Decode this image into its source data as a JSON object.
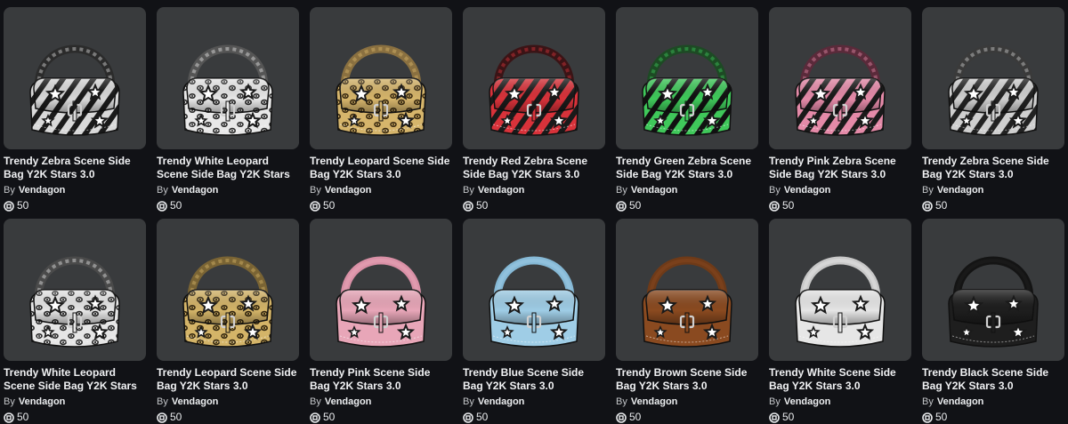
{
  "catalog": {
    "currency_icon": "robux-icon",
    "items": [
      {
        "name": "Trendy Zebra Scene Side Bag Y2K Stars 3.0",
        "by": "By",
        "creator": "Vendagon",
        "price": "50",
        "pattern": "zebra",
        "colors": {
          "base": "#d9d9d9",
          "accent": "#1a1a1a",
          "strap": "#2b2b2b"
        }
      },
      {
        "name": "Trendy White Leopard Scene Side Bag Y2K Stars 3.0",
        "by": "By",
        "creator": "Vendagon",
        "price": "50",
        "pattern": "leopard",
        "colors": {
          "base": "#e8e8e8",
          "accent": "#2a2a2a",
          "strap": "#555555"
        }
      },
      {
        "name": "Trendy Leopard Scene Side Bag Y2K Stars 3.0",
        "by": "By",
        "creator": "Vendagon",
        "price": "50",
        "pattern": "leopard",
        "colors": {
          "base": "#d6b56b",
          "accent": "#3a2a10",
          "strap": "#8a7040"
        }
      },
      {
        "name": "Trendy Red Zebra Scene Side Bag Y2K Stars 3.0",
        "by": "By",
        "creator": "Vendagon",
        "price": "50",
        "pattern": "zebra",
        "colors": {
          "base": "#d8323a",
          "accent": "#1a1a1a",
          "strap": "#3a1416"
        }
      },
      {
        "name": "Trendy Green Zebra Scene Side Bag Y2K Stars 3.0",
        "by": "By",
        "creator": "Vendagon",
        "price": "50",
        "pattern": "zebra",
        "colors": {
          "base": "#3fc85a",
          "accent": "#111111",
          "strap": "#1d4a24"
        }
      },
      {
        "name": "Trendy Pink Zebra Scene Side Bag Y2K Stars 3.0",
        "by": "By",
        "creator": "Vendagon",
        "price": "50",
        "pattern": "zebra",
        "colors": {
          "base": "#e48aa8",
          "accent": "#1a1a1a",
          "strap": "#5a2a3a"
        }
      },
      {
        "name": "Trendy Zebra Scene Side Bag Y2K Stars 3.0",
        "by": "By",
        "creator": "Vendagon",
        "price": "50",
        "pattern": "zebra",
        "colors": {
          "base": "#cfcfcf",
          "accent": "#222222",
          "strap": "#3a3a3a"
        }
      },
      {
        "name": "Trendy White Leopard Scene Side Bag Y2K Stars 3.0",
        "by": "By",
        "creator": "Vendagon",
        "price": "50",
        "pattern": "leopard",
        "colors": {
          "base": "#e6e6e6",
          "accent": "#2a2a2a",
          "strap": "#4a4a4a"
        }
      },
      {
        "name": "Trendy Leopard Scene Side Bag Y2K Stars 3.0",
        "by": "By",
        "creator": "Vendagon",
        "price": "50",
        "pattern": "leopard",
        "colors": {
          "base": "#d4b468",
          "accent": "#33260e",
          "strap": "#7a6434"
        }
      },
      {
        "name": "Trendy Pink Scene Side Bag Y2K Stars 3.0",
        "by": "By",
        "creator": "Vendagon",
        "price": "50",
        "pattern": "solid",
        "colors": {
          "base": "#e8a6b8",
          "accent": "#ffffff",
          "strap": "#d990a6"
        }
      },
      {
        "name": "Trendy Blue Scene Side Bag Y2K Stars 3.0",
        "by": "By",
        "creator": "Vendagon",
        "price": "50",
        "pattern": "solid",
        "colors": {
          "base": "#9fcde6",
          "accent": "#ffffff",
          "strap": "#86b9d6"
        }
      },
      {
        "name": "Trendy Brown Scene Side Bag Y2K Stars 3.0",
        "by": "By",
        "creator": "Vendagon",
        "price": "50",
        "pattern": "solid",
        "colors": {
          "base": "#8a4a20",
          "accent": "#ffffff",
          "strap": "#6e3a18"
        }
      },
      {
        "name": "Trendy White Scene Side Bag Y2K Stars 3.0",
        "by": "By",
        "creator": "Vendagon",
        "price": "50",
        "pattern": "solid",
        "colors": {
          "base": "#e6e6e6",
          "accent": "#ffffff",
          "strap": "#c8c8c8"
        }
      },
      {
        "name": "Trendy Black Scene Side Bag Y2K Stars 3.0",
        "by": "By",
        "creator": "Vendagon",
        "price": "50",
        "pattern": "solid",
        "colors": {
          "base": "#1e1e1e",
          "accent": "#ffffff",
          "strap": "#141414"
        }
      }
    ]
  }
}
